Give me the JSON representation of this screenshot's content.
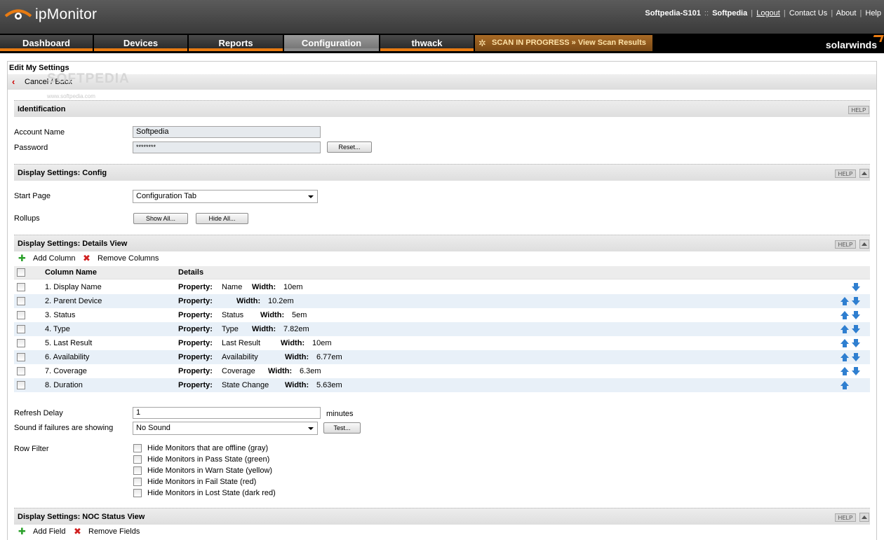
{
  "app": {
    "brand": "ipMonitor",
    "company": "solarwinds"
  },
  "top_links": {
    "user": "Softpedia-S101",
    "sep1": "::",
    "site": "Softpedia",
    "logout": "Logout",
    "contact": "Contact Us",
    "about": "About",
    "help": "Help"
  },
  "nav": {
    "tabs": [
      {
        "label": "Dashboard"
      },
      {
        "label": "Devices"
      },
      {
        "label": "Reports"
      },
      {
        "label": "Configuration"
      },
      {
        "label": "thwack"
      }
    ],
    "scan_text": "SCAN IN PROGRESS » View Scan Results",
    "active_tab": "Configuration"
  },
  "page": {
    "title": "Edit My Settings",
    "cancel": "Cancel / Back",
    "watermark": "SOFTPEDIA",
    "watermark_url": "www.softpedia.com"
  },
  "identification": {
    "title": "Identification",
    "help": "HELP",
    "account_label": "Account Name",
    "account_value": "Softpedia",
    "password_label": "Password",
    "password_value": "********",
    "reset": "Reset..."
  },
  "config": {
    "title": "Display Settings: Config",
    "help": "HELP",
    "start_label": "Start Page",
    "start_value": "Configuration Tab",
    "rollups_label": "Rollups",
    "show_all": "Show All...",
    "hide_all": "Hide All..."
  },
  "details": {
    "title": "Display Settings: Details View",
    "help": "HELP",
    "add_column": "Add Column",
    "remove_columns": "Remove Columns",
    "col_name": "Column Name",
    "col_details": "Details",
    "prop_label": "Property:",
    "width_label": "Width:",
    "rows": [
      {
        "name": "1. Display Name",
        "property": "Name",
        "width": "10em",
        "up": false,
        "down": true
      },
      {
        "name": "2. Parent Device",
        "property": "",
        "width": "10.2em",
        "up": true,
        "down": true
      },
      {
        "name": "3. Status",
        "property": "Status",
        "width": "5em",
        "up": true,
        "down": true
      },
      {
        "name": "4. Type",
        "property": "Type",
        "width": "7.82em",
        "up": true,
        "down": true
      },
      {
        "name": "5. Last Result",
        "property": "Last Result",
        "width": "10em",
        "up": true,
        "down": true
      },
      {
        "name": "6. Availability",
        "property": "Availability",
        "width": "6.77em",
        "up": true,
        "down": true
      },
      {
        "name": "7. Coverage",
        "property": "Coverage",
        "width": "6.3em",
        "up": true,
        "down": true
      },
      {
        "name": "8. Duration",
        "property": "State Change",
        "width": "5.63em",
        "up": true,
        "down": false
      }
    ],
    "refresh_label": "Refresh Delay",
    "refresh_value": "1",
    "refresh_unit": "minutes",
    "sound_label": "Sound if failures are showing",
    "sound_value": "No Sound",
    "test": "Test...",
    "row_filter_label": "Row Filter",
    "filters": [
      "Hide Monitors that are offline (gray)",
      "Hide Monitors in Pass State (green)",
      "Hide Monitors in Warn State (yellow)",
      "Hide Monitors in Fail State (red)",
      "Hide Monitors in Lost State (dark red)"
    ]
  },
  "noc": {
    "title": "Display Settings: NOC Status View",
    "help": "HELP",
    "add_field": "Add Field",
    "remove_fields": "Remove Fields"
  },
  "colors": {
    "accent": "#e87b12",
    "up_down_arrow": "#2f7fd0",
    "alt_row": "#e8f0f8"
  }
}
